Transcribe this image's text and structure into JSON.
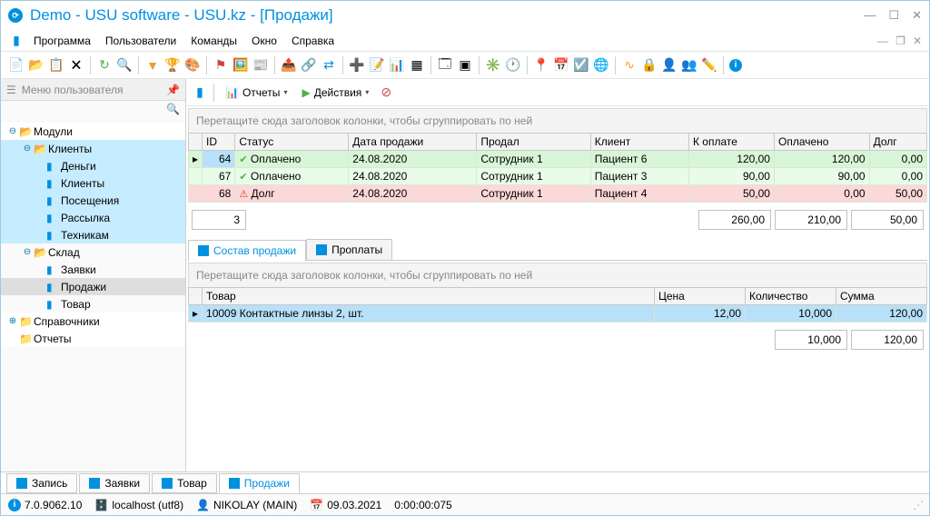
{
  "title": "Demo - USU software - USU.kz - [Продажи]",
  "menu": {
    "items": [
      "Программа",
      "Пользователи",
      "Команды",
      "Окно",
      "Справка"
    ]
  },
  "sidebar": {
    "header": "Меню пользователя",
    "nodes": {
      "modules": "Модули",
      "clients": "Клиенты",
      "money": "Деньги",
      "clients2": "Клиенты",
      "visits": "Посещения",
      "mailing": "Рассылка",
      "tech": "Техникам",
      "warehouse": "Склад",
      "requests": "Заявки",
      "sales": "Продажи",
      "goods": "Товар",
      "refs": "Справочники",
      "reports": "Отчеты"
    }
  },
  "toolbar2": {
    "reports": "Отчеты",
    "actions": "Действия"
  },
  "grouphint": "Перетащите сюда заголовок колонки, чтобы сгруппировать по ней",
  "grid": {
    "headers": {
      "id": "ID",
      "status": "Статус",
      "date": "Дата продажи",
      "seller": "Продал",
      "client": "Клиент",
      "topay": "К оплате",
      "paid": "Оплачено",
      "debt": "Долг"
    },
    "rows": [
      {
        "id": "64",
        "status": "Оплачено",
        "date": "24.08.2020",
        "seller": "Сотрудник 1",
        "client": "Пациент 6",
        "topay": "120,00",
        "paid": "120,00",
        "debt": "0,00",
        "kind": "paid",
        "sel": true
      },
      {
        "id": "67",
        "status": "Оплачено",
        "date": "24.08.2020",
        "seller": "Сотрудник 1",
        "client": "Пациент 3",
        "topay": "90,00",
        "paid": "90,00",
        "debt": "0,00",
        "kind": "paid"
      },
      {
        "id": "68",
        "status": "Долг",
        "date": "24.08.2020",
        "seller": "Сотрудник 1",
        "client": "Пациент 4",
        "topay": "50,00",
        "paid": "0,00",
        "debt": "50,00",
        "kind": "debt"
      }
    ],
    "summary": {
      "count": "3",
      "topay": "260,00",
      "paid": "210,00",
      "debt": "50,00"
    }
  },
  "subtabs": {
    "compose": "Состав продажи",
    "payments": "Проплаты"
  },
  "detail": {
    "headers": {
      "item": "Товар",
      "price": "Цена",
      "qty": "Количество",
      "sum": "Сумма"
    },
    "row": {
      "item": "10009 Контактные линзы 2, шт.",
      "price": "12,00",
      "qty": "10,000",
      "sum": "120,00"
    },
    "summary": {
      "qty": "10,000",
      "sum": "120,00"
    }
  },
  "bottomtabs": {
    "record": "Запись",
    "requests": "Заявки",
    "goods": "Товар",
    "sales": "Продажи"
  },
  "status": {
    "ver": "7.0.9062.10",
    "host": "localhost (utf8)",
    "user": "NIKOLAY (MAIN)",
    "date": "09.03.2021",
    "time": "0:00:00:075"
  }
}
